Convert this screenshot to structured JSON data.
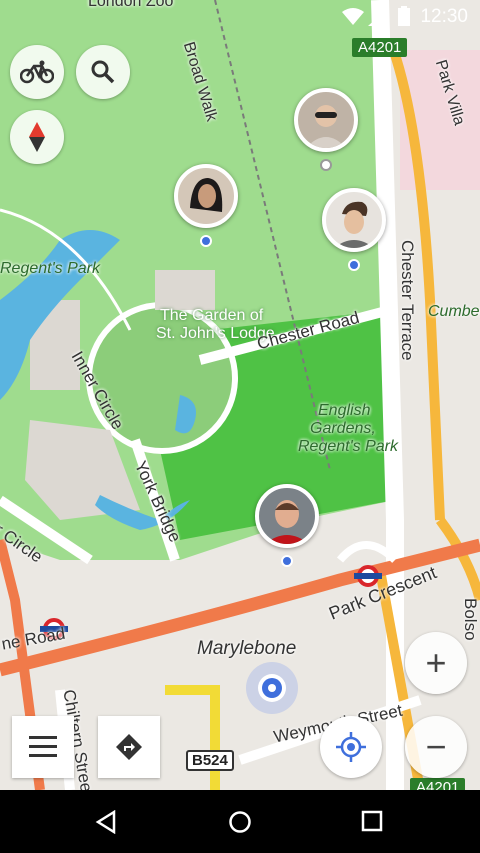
{
  "status_bar": {
    "time": "12:30"
  },
  "map": {
    "place_labels": {
      "london_zoo": "London Zoo",
      "broad_walk": "Broad Walk",
      "park_village": "Park Villa",
      "regents_park": "Regent's Park",
      "chester_terrace": "Chester Terrace",
      "cumberland": "Cumber",
      "garden_line1": "The Garden of",
      "garden_line2": "St. John's Lodge",
      "chester_road": "Chester Road",
      "inner_circle": "Inner Circle",
      "english_gardens_1": "English",
      "english_gardens_2": "Gardens,",
      "english_gardens_3": "Regent's Park",
      "york_bridge": "York Bridge",
      "outer_circle": "r Circle",
      "marylebone_road": "ne Road",
      "marylebone": "Marylebone",
      "park_crescent": "Park Crescent",
      "chiltern_street": "Chiltern Stree",
      "weymouth_street": "Weymouth Street",
      "bolsover": "Bolso"
    },
    "road_refs": {
      "a4201_top": "A4201",
      "b524": "B524",
      "a4201_bottom": "A4201"
    }
  },
  "controls": {
    "cycle_icon": "bicycle-icon",
    "search_icon": "search-icon",
    "compass_icon": "compass-icon",
    "menu_icon": "menu-icon",
    "route_icon": "directions-icon",
    "locate_icon": "my-location-icon",
    "zoom_in_label": "+",
    "zoom_out_label": "−"
  },
  "colors": {
    "park": "#8ed27e",
    "park_dark": "#5fbf4f",
    "water": "#5ab4e0",
    "primary_road": "#f07a4a",
    "secondary_road": "#f6b73c",
    "location": "#3f6fdc"
  }
}
